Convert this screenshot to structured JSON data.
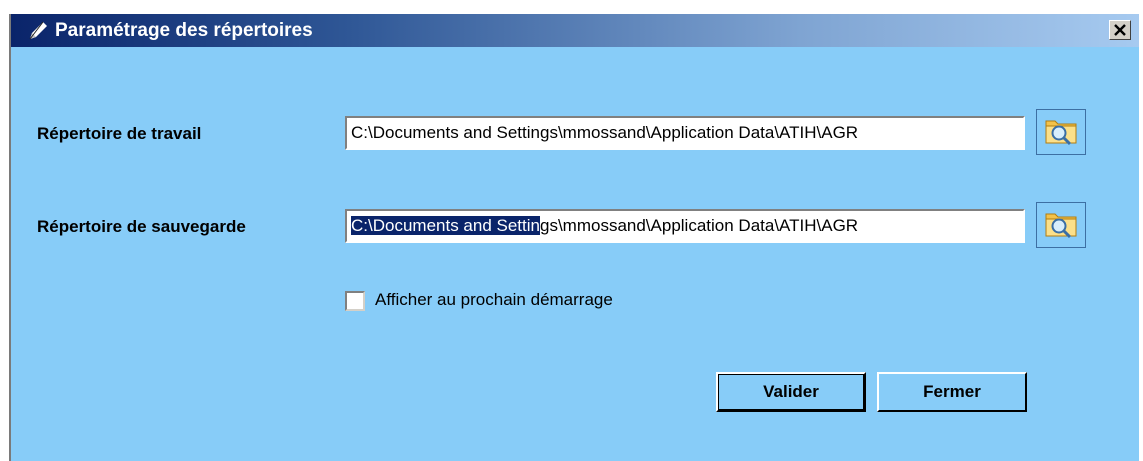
{
  "window": {
    "title": "Paramétrage des répertoires"
  },
  "fields": {
    "work": {
      "label": "Répertoire de travail",
      "value": "C:\\Documents and Settings\\mmossand\\Application Data\\ATIH\\AGR"
    },
    "save": {
      "label": "Répertoire de sauvegarde",
      "value_selected": "C:\\Documents and Settin",
      "value_rest": "gs\\mmossand\\Application Data\\ATIH\\AGR"
    }
  },
  "options": {
    "show_on_startup": {
      "label": "Afficher au prochain démarrage",
      "checked": false
    }
  },
  "buttons": {
    "validate": "Valider",
    "close": "Fermer"
  },
  "icons": {
    "title": "pencil-icon",
    "close": "close-x-icon",
    "browse": "folder-search-icon"
  },
  "colors": {
    "dialog_background": "#87ccf8",
    "titlebar_start": "#0a246a",
    "titlebar_end": "#a6caf0",
    "selection": "#0a246a"
  }
}
